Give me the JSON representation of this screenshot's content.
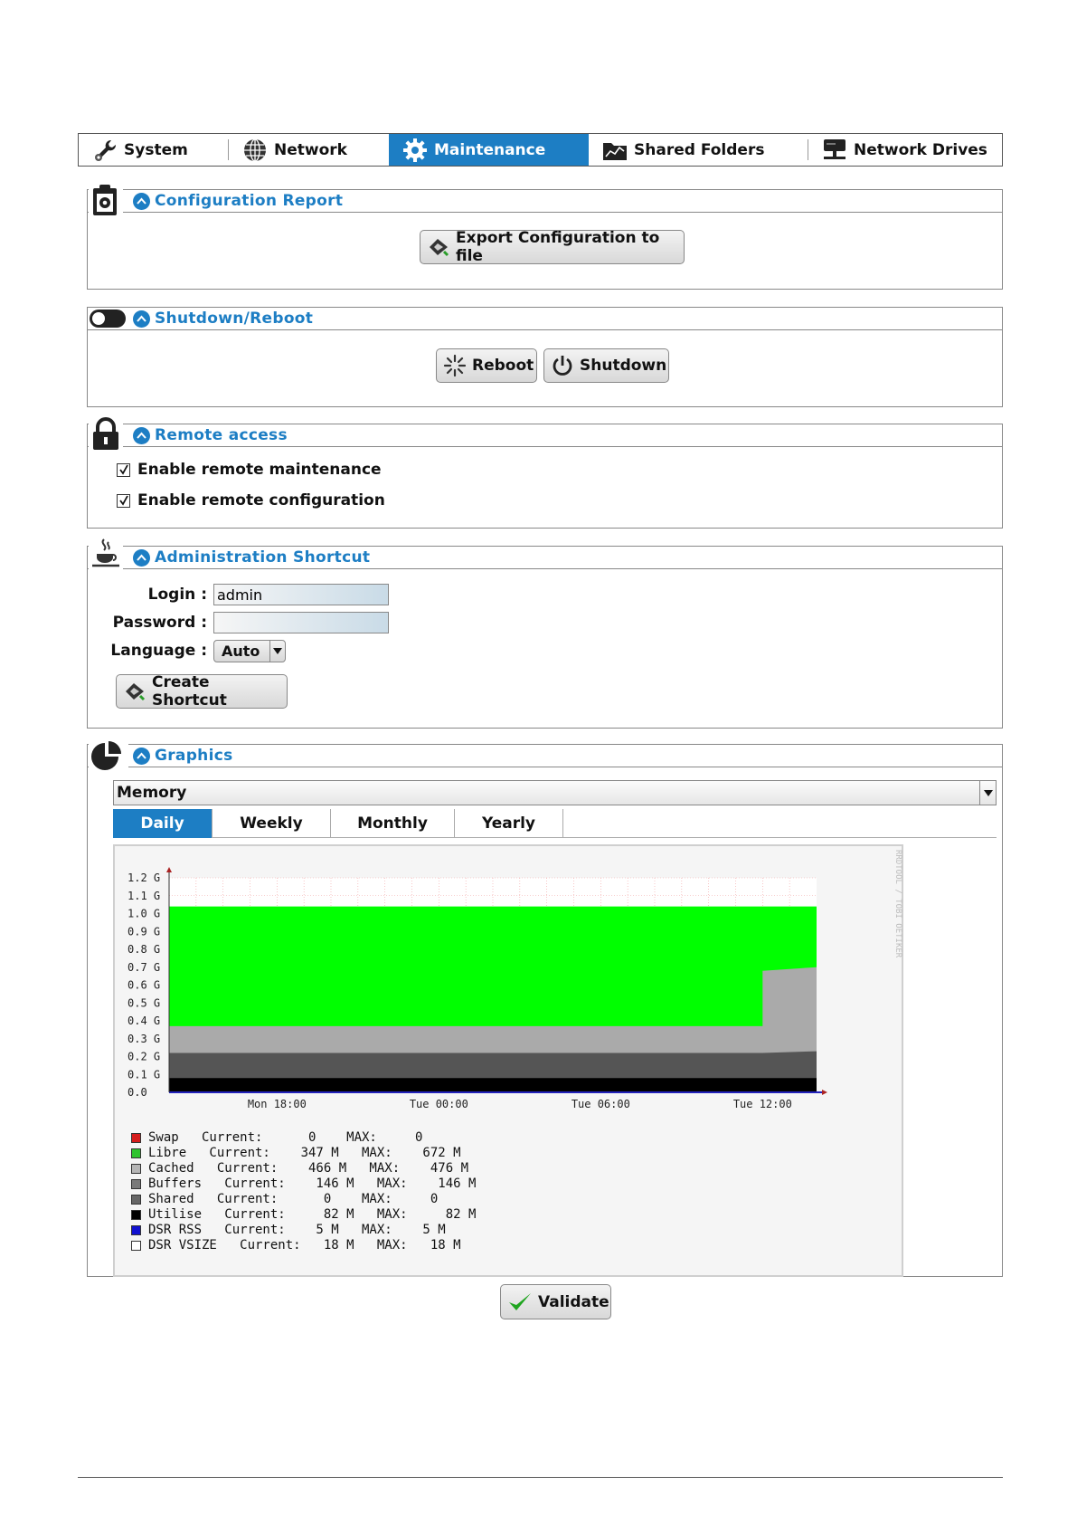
{
  "tabs": [
    {
      "label": "System",
      "icon": "wrench-icon"
    },
    {
      "label": "Network",
      "icon": "globe-icon"
    },
    {
      "label": "Maintenance",
      "icon": "gear-icon",
      "active": true
    },
    {
      "label": "Shared Folders",
      "icon": "shared-folder-icon"
    },
    {
      "label": "Network Drives",
      "icon": "network-drive-icon"
    }
  ],
  "config_report": {
    "title": "Configuration Report",
    "export_label": "Export Configuration to file"
  },
  "shutdown": {
    "title": "Shutdown/Reboot",
    "reboot_label": "Reboot",
    "shutdown_label": "Shutdown"
  },
  "remote": {
    "title": "Remote access",
    "maintenance_label": "Enable remote maintenance",
    "configuration_label": "Enable remote configuration",
    "maintenance_checked": true,
    "configuration_checked": true
  },
  "admin": {
    "title": "Administration Shortcut",
    "login_label": "Login :",
    "login_value": "admin",
    "password_label": "Password :",
    "language_label": "Language :",
    "language_value": "Auto",
    "create_label": "Create Shortcut"
  },
  "graphics": {
    "title": "Graphics",
    "select_value": "Memory",
    "subtabs": [
      "Daily",
      "Weekly",
      "Monthly",
      "Yearly"
    ],
    "active_subtab": "Daily",
    "watermark": "RRDTOOL / TOBI OETIKER"
  },
  "chart_data": {
    "type": "area",
    "title": "",
    "xlabel": "",
    "ylabel": "",
    "ylim": [
      0,
      1.2
    ],
    "y_ticks": [
      "0.0",
      "0.1 G",
      "0.2 G",
      "0.3 G",
      "0.4 G",
      "0.5 G",
      "0.6 G",
      "0.7 G",
      "0.8 G",
      "0.9 G",
      "1.0 G",
      "1.1 G",
      "1.2 G"
    ],
    "x_ticks": [
      "Mon 18:00",
      "Tue 00:00",
      "Tue 06:00",
      "Tue 12:00"
    ],
    "x_range_hours": [
      14,
      38
    ],
    "x": [
      14,
      36,
      36,
      38
    ],
    "series": [
      {
        "name": "Utilise",
        "color": "#000000",
        "values": [
          0.08,
          0.08,
          0.08,
          0.08
        ]
      },
      {
        "name": "Buffers",
        "color": "#555555",
        "values": [
          0.22,
          0.22,
          0.22,
          0.23
        ]
      },
      {
        "name": "Cached",
        "color": "#aaaaaa",
        "values": [
          0.37,
          0.37,
          0.68,
          0.7
        ]
      },
      {
        "name": "Libre",
        "color": "#00ff00",
        "values": [
          1.04,
          1.04,
          1.04,
          1.04
        ]
      }
    ],
    "legend": [
      {
        "name": "Swap",
        "color": "#d41c1c",
        "current": "0",
        "max": "0",
        "text": "Swap   Current:      0    MAX:     0"
      },
      {
        "name": "Libre",
        "color": "#2ec42e",
        "current": "347 M",
        "max": "672 M",
        "text": "Libre   Current:    347 M   MAX:    672 M"
      },
      {
        "name": "Cached",
        "color": "#b5b5b5",
        "current": "466 M",
        "max": "476 M",
        "text": "Cached   Current:    466 M   MAX:    476 M"
      },
      {
        "name": "Buffers",
        "color": "#7a7a7a",
        "current": "146 M",
        "max": "146 M",
        "text": "Buffers   Current:    146 M   MAX:    146 M"
      },
      {
        "name": "Shared",
        "color": "#666666",
        "current": "0",
        "max": "0",
        "text": "Shared   Current:      0    MAX:     0"
      },
      {
        "name": "Utilise",
        "color": "#000000",
        "current": "82 M",
        "max": "82 M",
        "text": "Utilise   Current:     82 M   MAX:     82 M"
      },
      {
        "name": "DSR RSS",
        "color": "#1010d0",
        "current": "5 M",
        "max": "5 M",
        "text": "DSR RSS   Current:    5 M   MAX:    5 M"
      },
      {
        "name": "DSR VSIZE",
        "color": "#ffffff",
        "current": "18 M",
        "max": "18 M",
        "text": "DSR VSIZE   Current:   18 M   MAX:   18 M"
      }
    ]
  },
  "validate_label": "Validate"
}
